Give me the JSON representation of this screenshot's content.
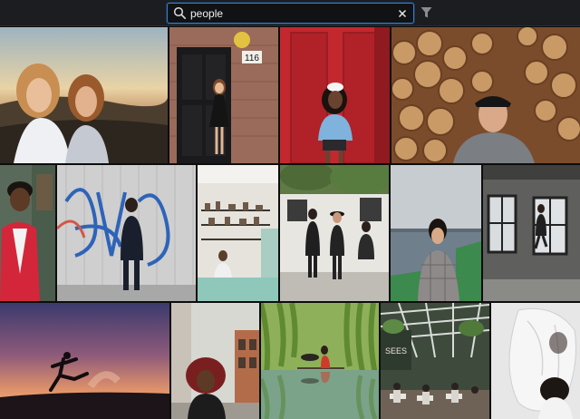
{
  "search": {
    "query": "people",
    "icon": "search-icon",
    "clear_icon": "close-icon"
  },
  "filter": {
    "icon": "funnel-filter-icon"
  },
  "building_number": "116",
  "mural_sign": "SEES",
  "colors": {
    "accent": "#2f7fd6",
    "toolbar": "#1c1d20",
    "background": "#0d0d0d"
  },
  "photos": [
    "two-women-sunset-hills-photo",
    "woman-black-dress-door-photo",
    "woman-red-door-photo",
    "man-cap-log-pile-photo",
    "man-red-jacket-photo",
    "man-graffiti-wall-photo",
    "cafe-counter-photo",
    "three-people-white-wall-photo",
    "woman-plaid-shirt-waterfront-photo",
    "man-window-warehouse-photo",
    "silhouette-sunset-jump-photo",
    "woman-curly-hair-street-photo",
    "man-dog-willow-pond-photo",
    "greenhouse-restaurant-photo",
    "woman-veil-sculpture-photo"
  ]
}
